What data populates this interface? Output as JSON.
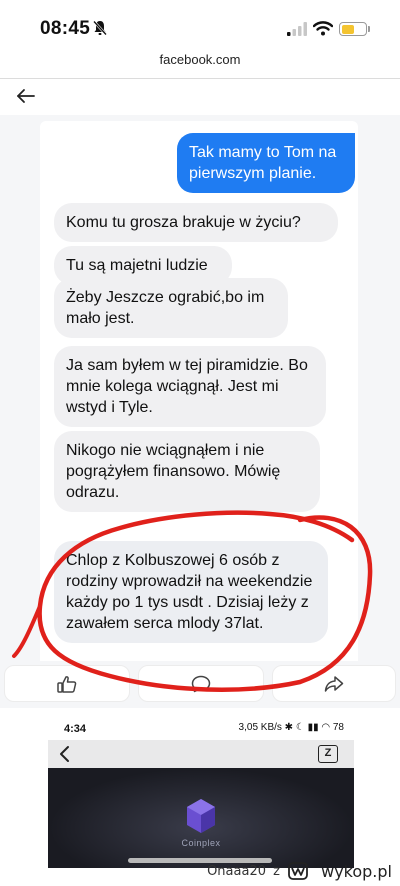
{
  "status_bar": {
    "time": "08:45",
    "battery_level": 0.55,
    "colors": {
      "battery": "#f4c430"
    }
  },
  "url_bar": {
    "domain": "facebook.com"
  },
  "chat": {
    "messages": [
      {
        "direction": "out",
        "text": "Tak mamy to Tom na pierwszym planie."
      },
      {
        "direction": "in",
        "text": "Komu tu grosza brakuje w życiu?"
      },
      {
        "direction": "in",
        "text": "Tu są majetni ludzie"
      },
      {
        "direction": "in",
        "text": "Żeby Jeszcze ograbić,bo im mało jest."
      },
      {
        "direction": "in",
        "text": "Ja sam byłem w tej piramidzie. Bo mnie kolega wciągnął. Jest mi wstyd i Tyle."
      },
      {
        "direction": "in",
        "text": "Nikogo nie wciągnąłem i nie pogrążyłem finansowo. Mówię odrazu."
      },
      {
        "direction": "in",
        "text": "Chlop z Kolbuszowej 6 osób z rodziny wprowadził na weekendzie każdy po 1 tys usdt . Dzisiaj leży z zawałem serca mlody 37lat."
      }
    ],
    "colors": {
      "outgoing": "#1f7cf2",
      "incoming": "#f0f0f2",
      "annotation": "#e0211b"
    }
  },
  "actions": [
    {
      "name": "like",
      "icon": "thumbs-up-icon"
    },
    {
      "name": "comment",
      "icon": "comment-icon"
    },
    {
      "name": "share",
      "icon": "share-icon"
    }
  ],
  "embedded_screenshot": {
    "time": "4:34",
    "status_right": "3,05 KB/s",
    "battery": "78",
    "icon_label": "Z",
    "logo_text": "Coinplex"
  },
  "watermark": {
    "user": "Onaaa20",
    "separator": "z",
    "site": "wykop.pl"
  }
}
